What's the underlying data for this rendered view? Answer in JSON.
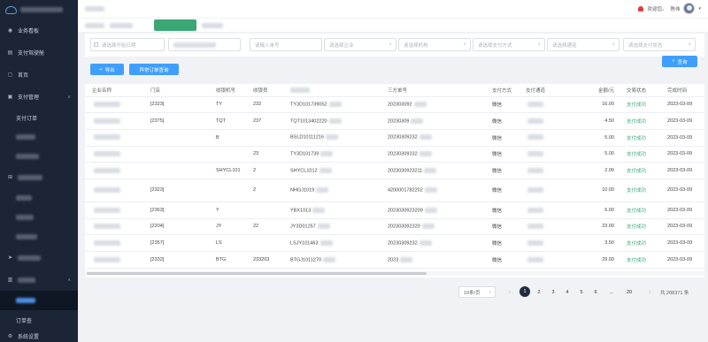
{
  "header": {
    "greeting": "欢迎您。",
    "user": "陈伟"
  },
  "sidebar": {
    "items": [
      {
        "label": "业务看板",
        "icon": "dashboard-icon"
      },
      {
        "label": "支付驾驶舱",
        "icon": "cockpit-icon"
      },
      {
        "label": "首页",
        "icon": "home-icon"
      },
      {
        "label": "支付管理",
        "icon": "payment-icon",
        "expanded": true
      }
    ],
    "sub_items": [
      "支付订单",
      "",
      "",
      "",
      "",
      "",
      "",
      "",
      "",
      "订单查"
    ],
    "footer": "系统设置"
  },
  "filters": {
    "date_start": "请选择开始日期",
    "order_no": "请输入单号",
    "company": "请选择企业",
    "org": "请选择机构",
    "pay_method": "请选择支付方式",
    "channel": "请选择通道",
    "pay_status": "请选择支付状态",
    "search_label": "查询"
  },
  "toolbar": {
    "export_label": "导出",
    "abnormal_label": "异常订单查询"
  },
  "table": {
    "columns": [
      "企业名称",
      "门店",
      "收银机号",
      "收银员",
      "",
      "三方单号",
      "支付方式",
      "支付通道",
      "金额/元",
      "交易状态",
      "完成时间"
    ],
    "rows": [
      [
        "",
        "[2323]",
        "TY",
        "232",
        "TY3D101739052",
        "202303092",
        "微信",
        "",
        "16.00",
        "支付成功",
        "2023-03-09"
      ],
      [
        "",
        "[2375]",
        "TQT",
        "237",
        "TQT1013402220",
        "20230309",
        "微信",
        "",
        "4.50",
        "支付成功",
        "2023-03-09"
      ],
      [
        "",
        "",
        "B",
        "",
        "BSLD10111216",
        "20230309232",
        "微信",
        "",
        "5.00",
        "支付成功",
        "2023-03-09"
      ],
      [
        "",
        "",
        "",
        "23",
        "TY3D101739",
        "20230309232",
        "微信",
        "",
        "5.00",
        "支付成功",
        "2023-03-09"
      ],
      [
        "",
        "",
        "SHYCL101",
        "2",
        "SHYCL1012",
        "2023030923211",
        "微信",
        "",
        "2.00",
        "支付成功",
        "2023-03-09"
      ],
      [
        "",
        "[2323]",
        "",
        "2",
        "NHGJ1019",
        "4200001782202",
        "微信",
        "",
        "10.00",
        "支付成功",
        "2023-03-09"
      ],
      [
        "",
        "[2363]",
        "Y",
        "",
        "YBX1013",
        "2023030923209",
        "微信",
        "",
        "6.00",
        "支付成功",
        "2023-03-09"
      ],
      [
        "",
        "[2204]",
        "JY",
        "22",
        "JY3D01257",
        "202303092320",
        "微信",
        "",
        "23.00",
        "支付成功",
        "2023-03-09"
      ],
      [
        "",
        "[2357]",
        "LS",
        "",
        "LSJY101463",
        "20230309232",
        "微信",
        "",
        "3.50",
        "支付成功",
        "2023-03-09"
      ],
      [
        "",
        "[2332]",
        "BTG",
        "233203",
        "BTGJ1011270",
        "2023",
        "微信",
        "",
        "29.00",
        "支付成功",
        "2023-03-09"
      ]
    ]
  },
  "pagination": {
    "page_size": "10条/页",
    "pages": [
      "1",
      "2",
      "3",
      "4",
      "5",
      "6",
      "...",
      "20"
    ],
    "active": "1",
    "total": "共 208371 条"
  },
  "colors": {
    "sidebar_bg": "#1c2536",
    "accent": "#409eff",
    "success": "#3ba776",
    "active_tab": "#3ba776"
  }
}
